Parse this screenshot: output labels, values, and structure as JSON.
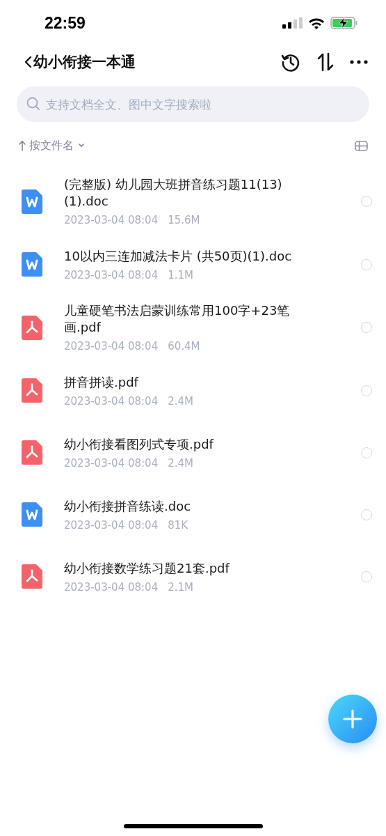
{
  "status_bar": {
    "time": "22:59"
  },
  "nav": {
    "title": "幼小衔接一本通"
  },
  "search": {
    "placeholder": "支持文档全文、图中文字搜索啦"
  },
  "sort": {
    "label": "按文件名"
  },
  "files": [
    {
      "kind": "doc",
      "name": "(完整版) 幼儿园大班拼音练习题11(13)(1).doc",
      "date": "2023-03-04 08:04",
      "size": "15.6M",
      "selected": false
    },
    {
      "kind": "doc",
      "name": "10以内三连加减法卡片 (共50页)(1).doc",
      "date": "2023-03-04 08:04",
      "size": "1.1M",
      "selected": false
    },
    {
      "kind": "pdf",
      "name": "儿童硬笔书法启蒙训练常用100字+23笔画.pdf",
      "date": "2023-03-04 08:04",
      "size": "60.4M",
      "selected": false
    },
    {
      "kind": "pdf",
      "name": "拼音拼读.pdf",
      "date": "2023-03-04 08:04",
      "size": "2.4M",
      "selected": false
    },
    {
      "kind": "pdf",
      "name": "幼小衔接看图列式专项.pdf",
      "date": "2023-03-04 08:04",
      "size": "2.4M",
      "selected": false
    },
    {
      "kind": "doc",
      "name": "幼小衔接拼音练读.doc",
      "date": "2023-03-04 08:04",
      "size": "81K",
      "selected": false
    },
    {
      "kind": "pdf",
      "name": "幼小衔接数学练习题21套.pdf",
      "date": "2023-03-04 08:04",
      "size": "2.1M",
      "selected": false
    }
  ]
}
